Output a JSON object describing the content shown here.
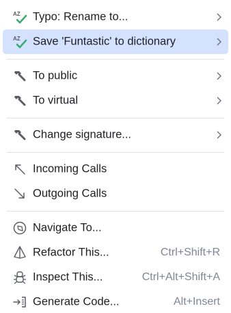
{
  "menu": {
    "typo_rename": "Typo: Rename to...",
    "save_dictionary": "Save 'Funtastic' to dictionary",
    "to_public": "To public",
    "to_virtual": "To virtual",
    "change_signature": "Change signature...",
    "incoming_calls": "Incoming Calls",
    "outgoing_calls": "Outgoing Calls",
    "navigate_to": "Navigate To...",
    "refactor_this": "Refactor This...",
    "refactor_shortcut": "Ctrl+Shift+R",
    "inspect_this": "Inspect This...",
    "inspect_shortcut": "Ctrl+Alt+Shift+A",
    "generate_code": "Generate Code...",
    "generate_shortcut": "Alt+Insert",
    "spell_icon_text": "AZ"
  },
  "colors": {
    "selected_bg": "#d4e2ff",
    "check_green": "#3bab6e",
    "icon_dark": "#5a5d63",
    "shortcut_gray": "#818594"
  },
  "icons": [
    "spellcheck-icon",
    "hammer-icon",
    "arrow-up-left-icon",
    "arrow-down-right-icon",
    "compass-icon",
    "refactor-icon",
    "inspect-icon",
    "generate-icon",
    "chevron-right-icon"
  ]
}
